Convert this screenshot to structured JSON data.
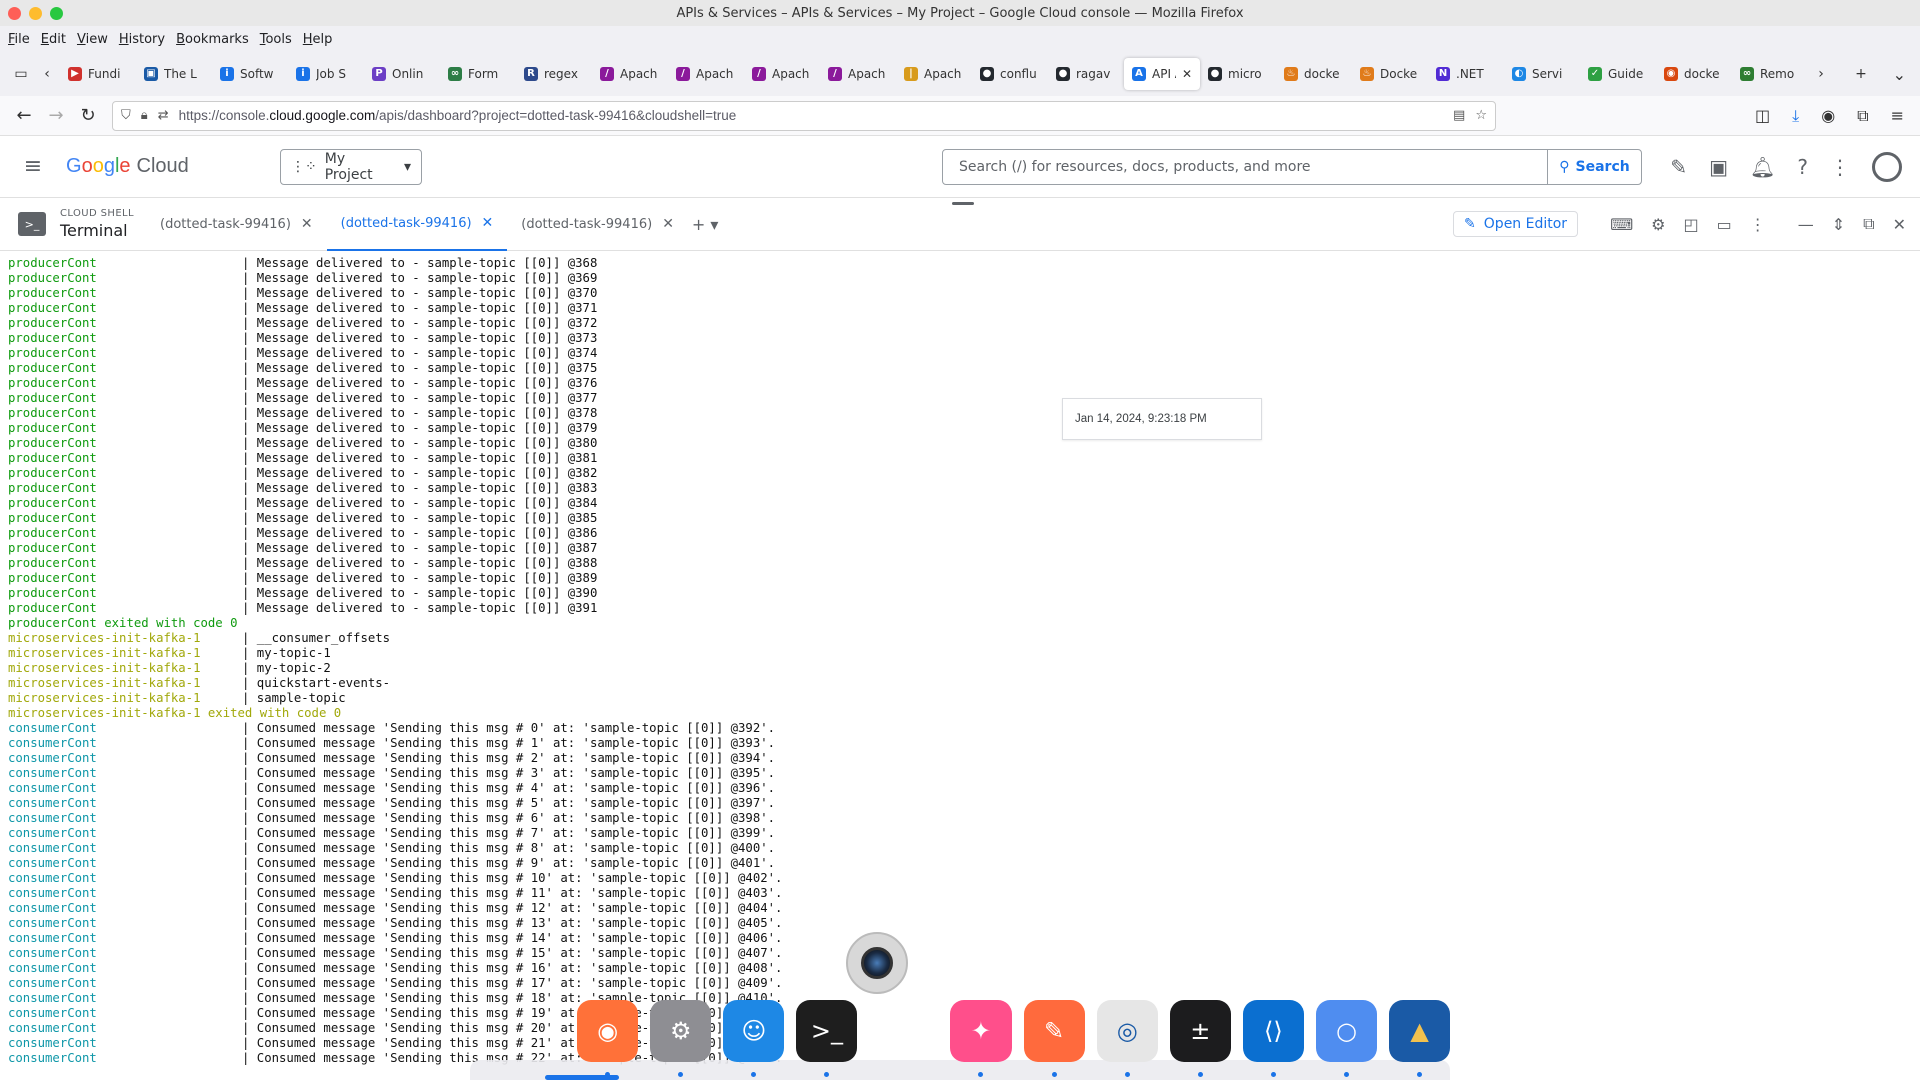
{
  "window": {
    "title": "APIs & Services – APIs & Services – My Project – Google Cloud console — Mozilla Firefox"
  },
  "menubar": [
    "File",
    "Edit",
    "View",
    "History",
    "Bookmarks",
    "Tools",
    "Help"
  ],
  "browser_tabs": [
    {
      "label": "Fundi",
      "color": "#d0312d",
      "glyph": "▶"
    },
    {
      "label": "The L",
      "color": "#1a5aa6",
      "glyph": "▣"
    },
    {
      "label": "Softw",
      "color": "#1a73e8",
      "glyph": "i"
    },
    {
      "label": "Job S",
      "color": "#1a73e8",
      "glyph": "i"
    },
    {
      "label": "Onlin",
      "color": "#6c3fc5",
      "glyph": "P"
    },
    {
      "label": "Form",
      "color": "#2d7d46",
      "glyph": "∞"
    },
    {
      "label": "regex",
      "color": "#2e4a8c",
      "glyph": "R"
    },
    {
      "label": "Apach",
      "color": "#8b1a9b",
      "glyph": "/"
    },
    {
      "label": "Apach",
      "color": "#8b1a9b",
      "glyph": "/"
    },
    {
      "label": "Apach",
      "color": "#8b1a9b",
      "glyph": "/"
    },
    {
      "label": "Apach",
      "color": "#8b1a9b",
      "glyph": "/"
    },
    {
      "label": "Apach",
      "color": "#d89b1c",
      "glyph": "|"
    },
    {
      "label": "conflu",
      "color": "#24292f",
      "glyph": "●"
    },
    {
      "label": "ragav",
      "color": "#24292f",
      "glyph": "●"
    },
    {
      "label": "API AP",
      "color": "#1a73e8",
      "glyph": "A",
      "active": true
    },
    {
      "label": "micro",
      "color": "#24292f",
      "glyph": "●"
    },
    {
      "label": "docke",
      "color": "#e07b1a",
      "glyph": "♨"
    },
    {
      "label": "Docke",
      "color": "#e07b1a",
      "glyph": "♨"
    },
    {
      "label": ".NET",
      "color": "#512bd4",
      "glyph": "N"
    },
    {
      "label": "Servi",
      "color": "#1e88e5",
      "glyph": "◐"
    },
    {
      "label": "Guide",
      "color": "#2ea043",
      "glyph": "✓"
    },
    {
      "label": "docke",
      "color": "#d9480f",
      "glyph": "◉"
    },
    {
      "label": "Remo",
      "color": "#2e7d32",
      "glyph": "∞"
    }
  ],
  "url": {
    "prefix": "https://console.",
    "domain": "cloud.google.com",
    "path": "/apis/dashboard?project=dotted-task-99416&cloudshell=true"
  },
  "gcp": {
    "logo_google": [
      "G",
      "o",
      "o",
      "g",
      "l",
      "e"
    ],
    "logo_cloud": "Cloud",
    "project": "My Project",
    "search_placeholder": "Search (/) for resources, docs, products, and more",
    "search_button": "Search"
  },
  "cloud_shell": {
    "section_label": "CLOUD SHELL",
    "title": "Terminal",
    "tabs": [
      {
        "label": "(dotted-task-99416)",
        "active": false
      },
      {
        "label": "(dotted-task-99416)",
        "active": true
      },
      {
        "label": "(dotted-task-99416)",
        "active": false
      }
    ],
    "open_editor": "Open Editor"
  },
  "timestamp_tooltip": "Jan 14, 2024, 9:23:18 PM",
  "terminal_lines": [
    {
      "svc": "producerCont",
      "kind": "prod",
      "msg": "| Message delivered to - sample-topic [[0]] @368"
    },
    {
      "svc": "producerCont",
      "kind": "prod",
      "msg": "| Message delivered to - sample-topic [[0]] @369"
    },
    {
      "svc": "producerCont",
      "kind": "prod",
      "msg": "| Message delivered to - sample-topic [[0]] @370"
    },
    {
      "svc": "producerCont",
      "kind": "prod",
      "msg": "| Message delivered to - sample-topic [[0]] @371"
    },
    {
      "svc": "producerCont",
      "kind": "prod",
      "msg": "| Message delivered to - sample-topic [[0]] @372"
    },
    {
      "svc": "producerCont",
      "kind": "prod",
      "msg": "| Message delivered to - sample-topic [[0]] @373"
    },
    {
      "svc": "producerCont",
      "kind": "prod",
      "msg": "| Message delivered to - sample-topic [[0]] @374"
    },
    {
      "svc": "producerCont",
      "kind": "prod",
      "msg": "| Message delivered to - sample-topic [[0]] @375"
    },
    {
      "svc": "producerCont",
      "kind": "prod",
      "msg": "| Message delivered to - sample-topic [[0]] @376"
    },
    {
      "svc": "producerCont",
      "kind": "prod",
      "msg": "| Message delivered to - sample-topic [[0]] @377"
    },
    {
      "svc": "producerCont",
      "kind": "prod",
      "msg": "| Message delivered to - sample-topic [[0]] @378"
    },
    {
      "svc": "producerCont",
      "kind": "prod",
      "msg": "| Message delivered to - sample-topic [[0]] @379"
    },
    {
      "svc": "producerCont",
      "kind": "prod",
      "msg": "| Message delivered to - sample-topic [[0]] @380"
    },
    {
      "svc": "producerCont",
      "kind": "prod",
      "msg": "| Message delivered to - sample-topic [[0]] @381"
    },
    {
      "svc": "producerCont",
      "kind": "prod",
      "msg": "| Message delivered to - sample-topic [[0]] @382"
    },
    {
      "svc": "producerCont",
      "kind": "prod",
      "msg": "| Message delivered to - sample-topic [[0]] @383"
    },
    {
      "svc": "producerCont",
      "kind": "prod",
      "msg": "| Message delivered to - sample-topic [[0]] @384"
    },
    {
      "svc": "producerCont",
      "kind": "prod",
      "msg": "| Message delivered to - sample-topic [[0]] @385"
    },
    {
      "svc": "producerCont",
      "kind": "prod",
      "msg": "| Message delivered to - sample-topic [[0]] @386"
    },
    {
      "svc": "producerCont",
      "kind": "prod",
      "msg": "| Message delivered to - sample-topic [[0]] @387"
    },
    {
      "svc": "producerCont",
      "kind": "prod",
      "msg": "| Message delivered to - sample-topic [[0]] @388"
    },
    {
      "svc": "producerCont",
      "kind": "prod",
      "msg": "| Message delivered to - sample-topic [[0]] @389"
    },
    {
      "svc": "producerCont",
      "kind": "prod",
      "msg": "| Message delivered to - sample-topic [[0]] @390"
    },
    {
      "svc": "producerCont",
      "kind": "prod",
      "msg": "| Message delivered to - sample-topic [[0]] @391"
    },
    {
      "exit": "producerCont exited with code 0",
      "kind": "exit-prod"
    },
    {
      "svc": "microservices-init-kafka-1",
      "kind": "kafka",
      "msg": "| __consumer_offsets"
    },
    {
      "svc": "microservices-init-kafka-1",
      "kind": "kafka",
      "msg": "| my-topic-1"
    },
    {
      "svc": "microservices-init-kafka-1",
      "kind": "kafka",
      "msg": "| my-topic-2"
    },
    {
      "svc": "microservices-init-kafka-1",
      "kind": "kafka",
      "msg": "| quickstart-events-"
    },
    {
      "svc": "microservices-init-kafka-1",
      "kind": "kafka",
      "msg": "| sample-topic"
    },
    {
      "exit": "microservices-init-kafka-1 exited with code 0",
      "kind": "exit-kafka"
    },
    {
      "svc": "consumerCont",
      "kind": "cons",
      "msg": "| Consumed message 'Sending this msg # 0' at: 'sample-topic [[0]] @392'."
    },
    {
      "svc": "consumerCont",
      "kind": "cons",
      "msg": "| Consumed message 'Sending this msg # 1' at: 'sample-topic [[0]] @393'."
    },
    {
      "svc": "consumerCont",
      "kind": "cons",
      "msg": "| Consumed message 'Sending this msg # 2' at: 'sample-topic [[0]] @394'."
    },
    {
      "svc": "consumerCont",
      "kind": "cons",
      "msg": "| Consumed message 'Sending this msg # 3' at: 'sample-topic [[0]] @395'."
    },
    {
      "svc": "consumerCont",
      "kind": "cons",
      "msg": "| Consumed message 'Sending this msg # 4' at: 'sample-topic [[0]] @396'."
    },
    {
      "svc": "consumerCont",
      "kind": "cons",
      "msg": "| Consumed message 'Sending this msg # 5' at: 'sample-topic [[0]] @397'."
    },
    {
      "svc": "consumerCont",
      "kind": "cons",
      "msg": "| Consumed message 'Sending this msg # 6' at: 'sample-topic [[0]] @398'."
    },
    {
      "svc": "consumerCont",
      "kind": "cons",
      "msg": "| Consumed message 'Sending this msg # 7' at: 'sample-topic [[0]] @399'."
    },
    {
      "svc": "consumerCont",
      "kind": "cons",
      "msg": "| Consumed message 'Sending this msg # 8' at: 'sample-topic [[0]] @400'."
    },
    {
      "svc": "consumerCont",
      "kind": "cons",
      "msg": "| Consumed message 'Sending this msg # 9' at: 'sample-topic [[0]] @401'."
    },
    {
      "svc": "consumerCont",
      "kind": "cons",
      "msg": "| Consumed message 'Sending this msg # 10' at: 'sample-topic [[0]] @402'."
    },
    {
      "svc": "consumerCont",
      "kind": "cons",
      "msg": "| Consumed message 'Sending this msg # 11' at: 'sample-topic [[0]] @403'."
    },
    {
      "svc": "consumerCont",
      "kind": "cons",
      "msg": "| Consumed message 'Sending this msg # 12' at: 'sample-topic [[0]] @404'."
    },
    {
      "svc": "consumerCont",
      "kind": "cons",
      "msg": "| Consumed message 'Sending this msg # 13' at: 'sample-topic [[0]] @405'."
    },
    {
      "svc": "consumerCont",
      "kind": "cons",
      "msg": "| Consumed message 'Sending this msg # 14' at: 'sample-topic [[0]] @406'."
    },
    {
      "svc": "consumerCont",
      "kind": "cons",
      "msg": "| Consumed message 'Sending this msg # 15' at: 'sample-topic [[0]] @407'."
    },
    {
      "svc": "consumerCont",
      "kind": "cons",
      "msg": "| Consumed message 'Sending this msg # 16' at: 'sample-topic [[0]] @408'."
    },
    {
      "svc": "consumerCont",
      "kind": "cons",
      "msg": "| Consumed message 'Sending this msg # 17' at: 'sample-topic [[0]] @409'."
    },
    {
      "svc": "consumerCont",
      "kind": "cons",
      "msg": "| Consumed message 'Sending this msg # 18' at: 'sample-topic [[0]] @410'."
    },
    {
      "svc": "consumerCont",
      "kind": "cons",
      "msg": "| Consumed message 'Sending this msg # 19' at: 'sample-topic [[0]] @411'."
    },
    {
      "svc": "consumerCont",
      "kind": "cons",
      "msg": "| Consumed message 'Sending this msg # 20' at: 'sample-topic [[0]] @412'."
    },
    {
      "svc": "consumerCont",
      "kind": "cons",
      "msg": "| Consumed message 'Sending this msg # 21' at: 'sample-topic [[0]] @413'."
    },
    {
      "svc": "consumerCont",
      "kind": "cons",
      "msg": "| Consumed message 'Sending this msg # 22' at: 'sample-topic [[0]] @414'."
    }
  ],
  "dock": [
    {
      "name": "apple-icon",
      "glyph": "",
      "bg": "transparent",
      "fg": "#111"
    },
    {
      "name": "firefox-icon",
      "glyph": "◉",
      "bg": "#ff7139",
      "fg": "#fff",
      "dot": true
    },
    {
      "name": "system-settings-icon",
      "glyph": "⚙",
      "bg": "#8e8e93",
      "fg": "#fff",
      "dot": true
    },
    {
      "name": "finder-icon",
      "glyph": "☺",
      "bg": "#1e88e5",
      "fg": "#fff",
      "dot": true
    },
    {
      "name": "terminal-icon",
      "glyph": ">_",
      "bg": "#1e1e1e",
      "fg": "#fff",
      "dot": true
    },
    {
      "name": "gap",
      "glyph": ""
    },
    {
      "name": "safari-icon",
      "glyph": "✦",
      "bg": "#ff4f8b",
      "fg": "#fff",
      "dot": true
    },
    {
      "name": "pencil-app-icon",
      "glyph": "✎",
      "bg": "#ff6a3d",
      "fg": "#fff",
      "dot": true
    },
    {
      "name": "preview-icon",
      "glyph": "◎",
      "bg": "#e6e6e6",
      "fg": "#1a5aa6",
      "dot": true
    },
    {
      "name": "calculator-icon",
      "glyph": "±",
      "bg": "#1c1c1e",
      "fg": "#fff",
      "dot": true
    },
    {
      "name": "vscode-icon",
      "glyph": "⟨⟩",
      "bg": "#0b6fd0",
      "fg": "#fff",
      "dot": true
    },
    {
      "name": "chrome-icon",
      "glyph": "○",
      "bg": "#4f8df0",
      "fg": "#fff",
      "dot": true
    },
    {
      "name": "linux-app-icon",
      "glyph": "▲",
      "bg": "#1a5aa6",
      "fg": "#f2c14e",
      "dot": true
    }
  ]
}
